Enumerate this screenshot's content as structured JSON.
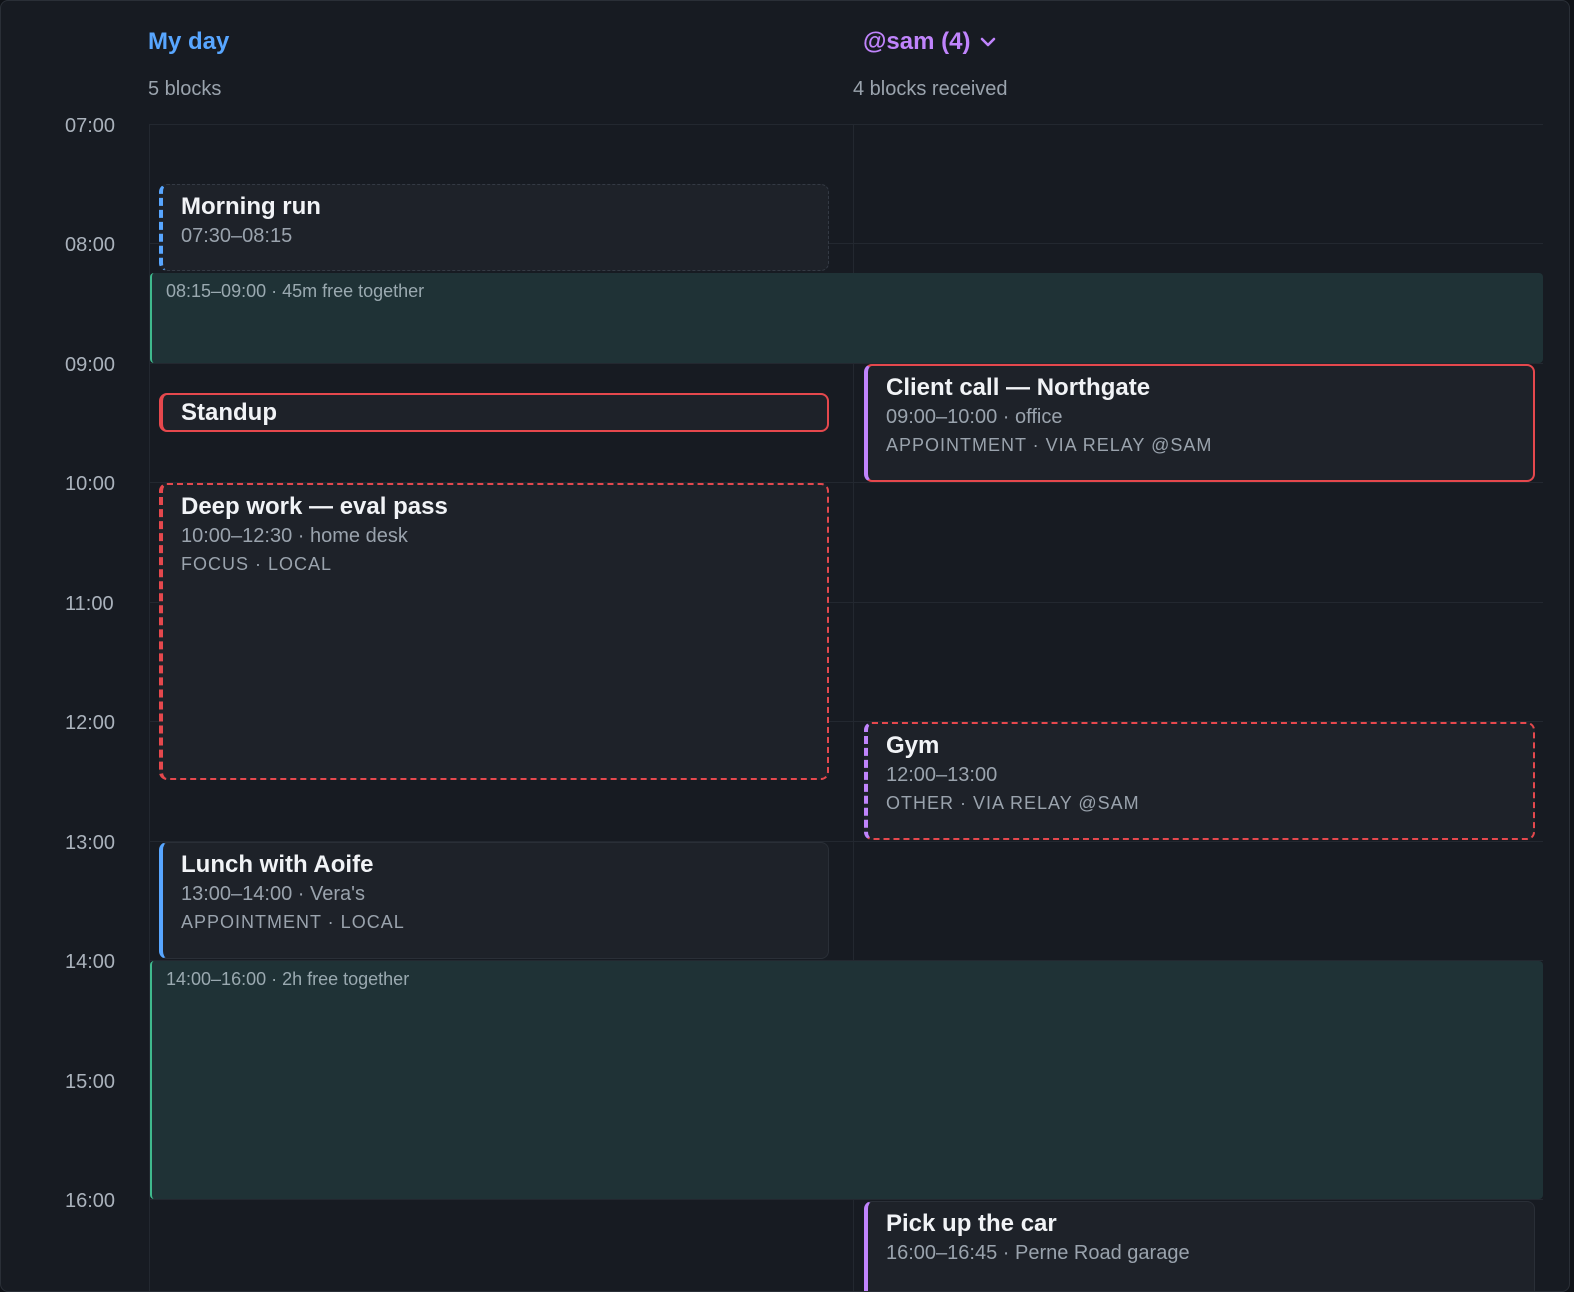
{
  "mine": {
    "title": "My day",
    "subtitle": "5 blocks"
  },
  "sam": {
    "title": "@sam (4)",
    "subtitle": "4 blocks received",
    "dropdown_icon": "chevron-down-icon"
  },
  "hours": [
    "07:00",
    "08:00",
    "09:00",
    "10:00",
    "11:00",
    "12:00",
    "13:00",
    "14:00",
    "15:00",
    "16:00"
  ],
  "free": [
    {
      "label": "08:15–09:00 · 45m free together"
    },
    {
      "label": "14:00–16:00 · 2h free together"
    }
  ],
  "my_blocks": [
    {
      "title": "Morning run",
      "time": "07:30–08:15",
      "meta": ""
    },
    {
      "title": "Standup",
      "time": "",
      "meta": ""
    },
    {
      "title": "Deep work — eval pass",
      "time": "10:00–12:30 · home desk",
      "meta": "FOCUS · LOCAL"
    },
    {
      "title": "Lunch with Aoife",
      "time": "13:00–14:00 · Vera's",
      "meta": "APPOINTMENT · LOCAL"
    }
  ],
  "sam_blocks": [
    {
      "title": "Client call — Northgate",
      "time": "09:00–10:00 · office",
      "meta": "APPOINTMENT · VIA RELAY @SAM"
    },
    {
      "title": "Gym",
      "time": "12:00–13:00",
      "meta": "OTHER · VIA RELAY @SAM"
    },
    {
      "title": "Pick up the car",
      "time": "16:00–16:45 · Perne Road garage",
      "meta": ""
    }
  ],
  "colors": {
    "mine_accent": "#58a6ff",
    "sam_accent": "#c084fc",
    "conflict": "#e5484d",
    "free": "#3fb98d",
    "background": "#171b22"
  }
}
